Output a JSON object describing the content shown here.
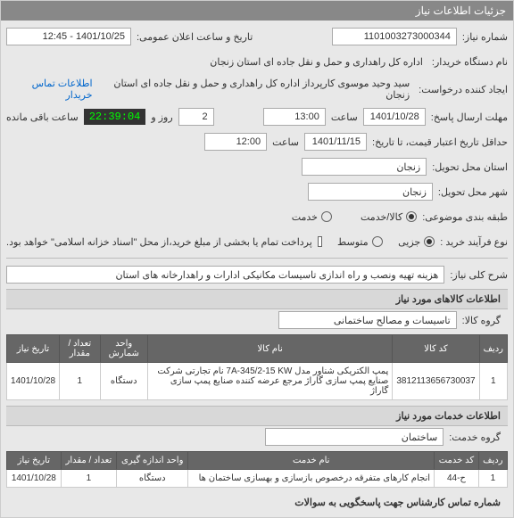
{
  "panel_title": "جزئیات اطلاعات نیاز",
  "labels": {
    "need_number": "شماره نیاز:",
    "buyer_org": "نام دستگاه خریدار:",
    "request_creator": "ایجاد کننده درخواست:",
    "send_deadline": "مهلت ارسال پاسخ:",
    "price_deadline_from": "حداقل تاریخ اعتبار قیمت، تا تاریخ:",
    "buyer_province": "استان محل تحویل:",
    "buyer_city": "شهر محل تحویل:",
    "category": "طبقه بندی موضوعی:",
    "purchase_type": "نوع فرآیند خرید :",
    "general_desc": "شرح کلی نیاز:",
    "goods_info": "اطلاعات کالاهای مورد نیاز",
    "goods_group": "گروه کالا:",
    "services_info": "اطلاعات خدمات مورد نیاز",
    "service_group": "گروه خدمت:",
    "expert_phone": "شماره تماس کارشناس جهت پاسخگویی به سوالات",
    "public_datetime": "تاریخ و ساعت اعلان عمومی:",
    "hour": "ساعت",
    "day_and": "روز و",
    "remaining": "ساعت باقی مانده",
    "buyer_contact": "اطلاعات تماس خریدار",
    "goods_service": "کالا/خدمت",
    "service": "خدمت",
    "partial": "جزیی",
    "medium": "متوسط",
    "payment_note": "پرداخت تمام یا بخشی از مبلغ خرید،از محل \"اسناد خزانه اسلامی\" خواهد بود."
  },
  "values": {
    "need_number": "1101003273000344",
    "public_datetime": "1401/10/25 - 12:45",
    "buyer_org": "اداره کل راهداری و حمل و نقل جاده ای استان زنجان",
    "request_creator": "سید وحید موسوی کارپرداز اداره کل راهداری و حمل و نقل جاده ای استان زنجان",
    "send_deadline_date": "1401/10/28",
    "send_deadline_time": "13:00",
    "days_left": "2",
    "timer": "22:39:04",
    "price_deadline_date": "1401/11/15",
    "price_deadline_time": "12:00",
    "buyer_province": "زنجان",
    "buyer_city": "زنجان",
    "general_desc": "هزینه تهیه ونصب و راه اندازی تاسیسات مکانیکی ادارات  و راهدارخانه های استان",
    "goods_group": "تاسیسات و مصالح ساختمانی",
    "service_group": "ساختمان"
  },
  "goods_table": {
    "headers": [
      "ردیف",
      "کد کالا",
      "نام کالا",
      "واحد شمارش",
      "تعداد / مقدار",
      "تاریخ نیاز"
    ],
    "rows": [
      {
        "idx": "1",
        "code": "3812113656730037",
        "name": "پمپ الکتریکی شناور مدل 7A-345/2-15 KW نام تجارتی شرکت صنایع پمپ سازی گاراژ مرجع عرضه کننده صنایع پمپ سازی گاراژ",
        "unit": "دستگاه",
        "qty": "1",
        "date": "1401/10/28"
      }
    ]
  },
  "services_table": {
    "headers": [
      "ردیف",
      "کد خدمت",
      "نام خدمت",
      "واحد اندازه گیری",
      "تعداد / مقدار",
      "تاریخ نیاز"
    ],
    "rows": [
      {
        "idx": "1",
        "code": "ح-44",
        "name": "انجام کارهای متفرقه درخصوص بازسازی و بهسازی ساختمان ها",
        "unit": "دستگاه",
        "qty": "1",
        "date": "1401/10/28"
      }
    ]
  }
}
